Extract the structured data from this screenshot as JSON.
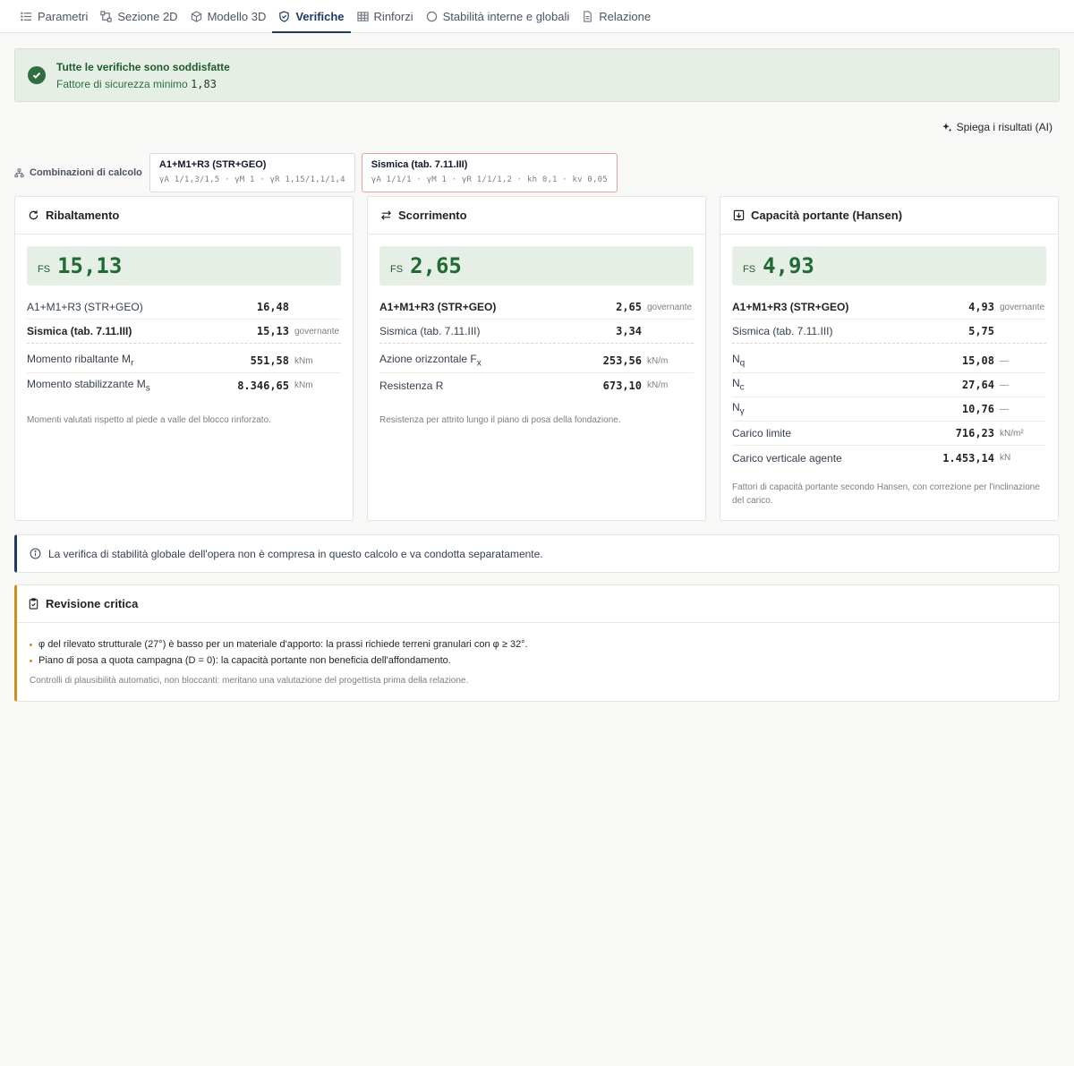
{
  "tabs": [
    {
      "label": "Parametri",
      "icon": "list-icon"
    },
    {
      "label": "Sezione 2D",
      "icon": "section-icon"
    },
    {
      "label": "Modello 3D",
      "icon": "cube-icon"
    },
    {
      "label": "Verifiche",
      "icon": "shield-check-icon",
      "active": true
    },
    {
      "label": "Rinforzi",
      "icon": "grid-icon"
    },
    {
      "label": "Stabilità interne e globali",
      "icon": "circle-icon"
    },
    {
      "label": "Relazione",
      "icon": "document-icon"
    }
  ],
  "banner": {
    "title": "Tutte le verifiche sono soddisfatte",
    "subtitle_label": "Fattore di sicurezza minimo",
    "min_factor": "1,83",
    "color": "#2f6f3f"
  },
  "ai_button": {
    "label": "Spiega i risultati (AI)"
  },
  "combinations": {
    "label": "Combinazioni di calcolo",
    "items": [
      {
        "title": "A1+M1+R3 (STR+GEO)",
        "params": "γA 1/1,3/1,5 · γM 1 · γR 1,15/1,1/1,4"
      },
      {
        "title": "Sismica (tab. 7.11.III)",
        "params": "γA 1/1/1 · γM 1 · γR 1/1/1,2 · kh 0,1 · kv 0,05"
      }
    ]
  },
  "cards": {
    "overturning": {
      "title": "Ribaltamento",
      "fs_label": "FS",
      "fs_value": "15,13",
      "rows": [
        {
          "label": "A1+M1+R3 (STR+GEO)",
          "value": "16,48",
          "unit": ""
        },
        {
          "label": "Sismica (tab. 7.11.III)",
          "value": "15,13",
          "unit": "governante"
        },
        {
          "label": "Momento ribaltante M",
          "sub": "r",
          "value": "551,58",
          "unit": "kNm"
        },
        {
          "label": "Momento stabilizzante M",
          "sub": "s",
          "value": "8.346,65",
          "unit": "kNm"
        }
      ],
      "note": "Momenti valutati rispetto al piede a valle del blocco rinforzato."
    },
    "sliding": {
      "title": "Scorrimento",
      "fs_label": "FS",
      "fs_value": "2,65",
      "rows": [
        {
          "label": "A1+M1+R3 (STR+GEO)",
          "value": "2,65",
          "unit": "governante"
        },
        {
          "label": "Sismica (tab. 7.11.III)",
          "value": "3,34",
          "unit": ""
        },
        {
          "label": "Azione orizzontale F",
          "sub": "x",
          "value": "253,56",
          "unit": "kN/m"
        },
        {
          "label": "Resistenza R",
          "value": "673,10",
          "unit": "kN/m"
        }
      ],
      "note": "Resistenza per attrito lungo il piano di posa della fondazione."
    },
    "bearing": {
      "title": "Capacità portante (Hansen)",
      "fs_label": "FS",
      "fs_value": "4,93",
      "rows": [
        {
          "label": "A1+M1+R3 (STR+GEO)",
          "value": "4,93",
          "unit": "governante"
        },
        {
          "label": "Sismica (tab. 7.11.III)",
          "value": "5,75",
          "unit": ""
        },
        {
          "label": "N",
          "sub": "q",
          "value": "15,08",
          "unit": "—"
        },
        {
          "label": "N",
          "sub": "c",
          "value": "27,64",
          "unit": "—"
        },
        {
          "label": "N",
          "sub": "γ",
          "value": "10,76",
          "unit": "—"
        },
        {
          "label": "Carico limite",
          "value": "716,23",
          "unit": "kN/m²"
        },
        {
          "label": "Carico verticale agente",
          "value": "1.453,14",
          "unit": "kN"
        }
      ],
      "note": "Fattori di capacità portante secondo Hansen, con correzione per l'inclinazione del carico."
    }
  },
  "info": {
    "text": "La verifica di stabilità globale dell'opera non è compresa in questo calcolo e va condotta separatamente."
  },
  "review": {
    "title": "Revisione critica",
    "items": [
      "φ del rilevato strutturale (27°) è basso per un materiale d'apporto: la prassi richiede terreni granulari con φ ≥ 32°.",
      "Piano di posa a quota campagna (D = 0): la capacità portante non beneficia dell'affondamento."
    ],
    "note": "Controlli di plausibilità automatici, non bloccanti: meritano una valutazione del progettista prima della relazione."
  }
}
